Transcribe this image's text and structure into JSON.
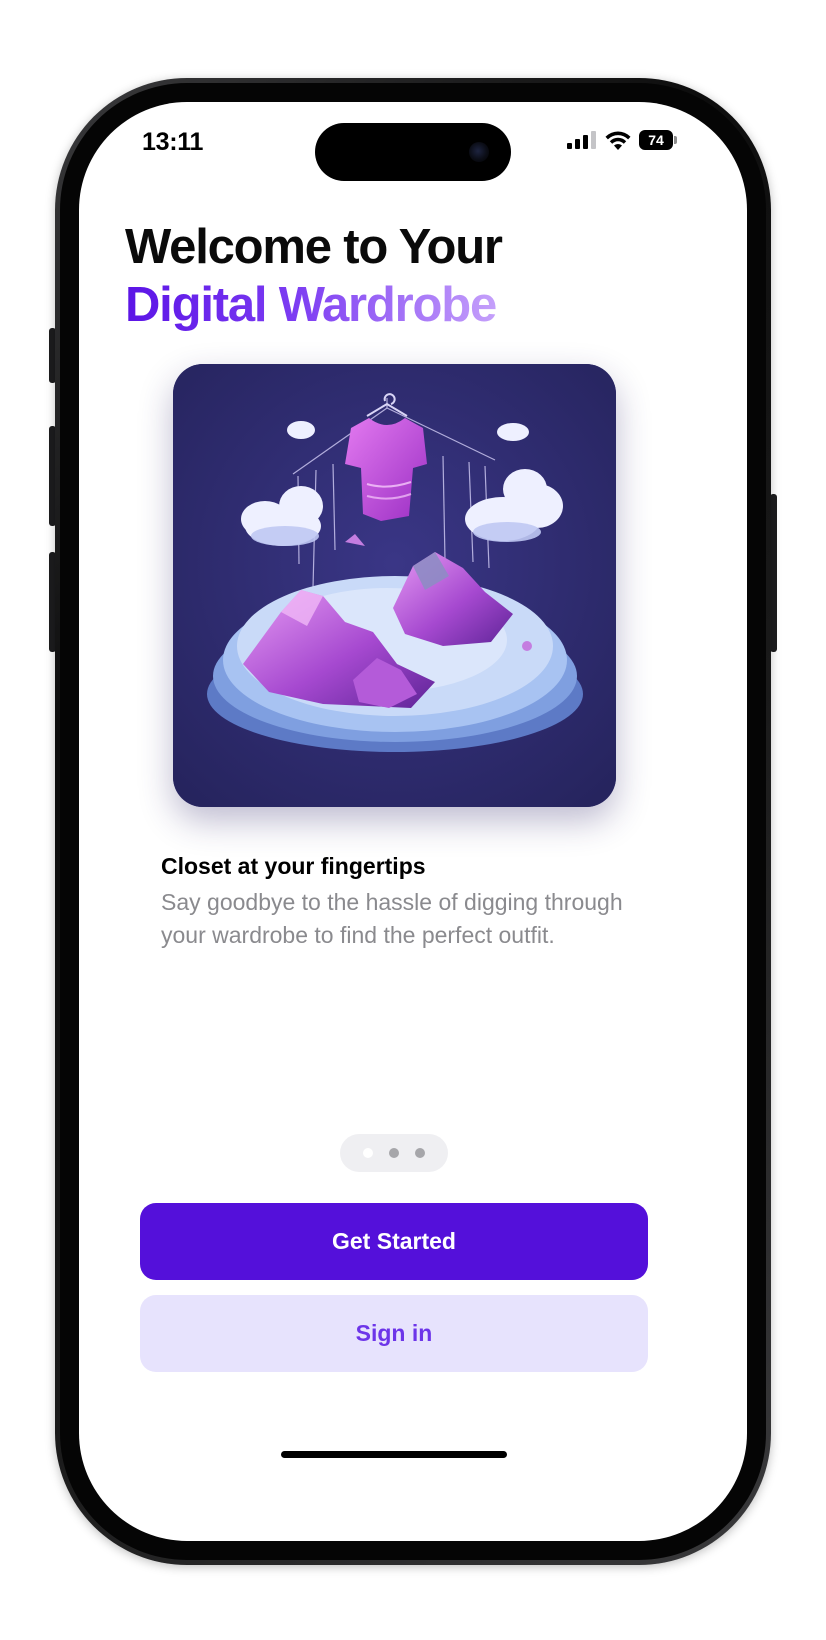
{
  "status_bar": {
    "time": "13:11",
    "battery": "74",
    "icons": [
      "cellular-signal-icon",
      "wifi-icon",
      "battery-icon"
    ]
  },
  "onboarding": {
    "title_line1": "Welcome to Your",
    "title_line2": "Digital Wardrobe",
    "hero_image": "floating-islands-hanging-shirt-illustration",
    "feature_title": "Closet at your fingertips",
    "feature_description": "Say goodbye to the hassle of digging through your wardrobe to find the perfect outfit."
  },
  "pager": {
    "total_pages": 3,
    "current_page": 1
  },
  "actions": {
    "primary_label": "Get Started",
    "secondary_label": "Sign in"
  },
  "colors": {
    "accent": "#5410DA",
    "secondary_button_bg": "#E7E3FD",
    "secondary_button_text": "#6D35E9",
    "gradient_start": "#5B14E6",
    "gradient_end": "#C7A3FB",
    "description_text": "#8A8A8E"
  }
}
